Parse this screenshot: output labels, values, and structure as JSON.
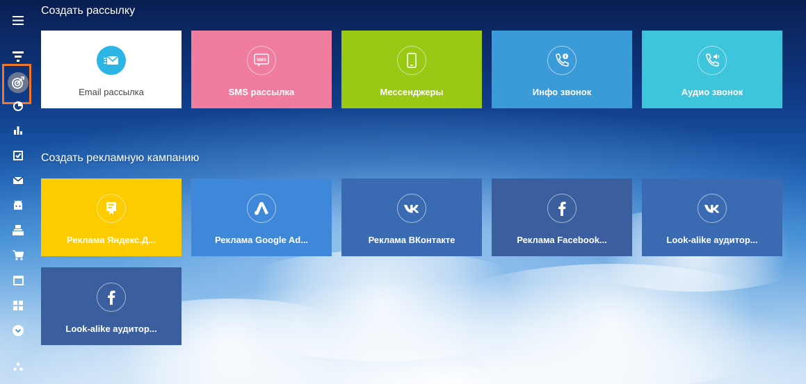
{
  "colors": {
    "email": "#ffffff",
    "sms": "#f07ca0",
    "messengers": "#99c815",
    "info_call": "#3a9bd8",
    "audio_call": "#3ec5dc",
    "yandex": "#fdcc00",
    "google": "#3f87d9",
    "vk": "#3a6ab2",
    "facebook": "#3b5e9e",
    "active_outline": "#f0772a"
  },
  "sidebar": {
    "items": [
      {
        "icon": "menu-icon"
      },
      {
        "icon": "funnel-icon"
      },
      {
        "icon": "target-icon",
        "active": true
      },
      {
        "icon": "pie-chart-icon"
      },
      {
        "icon": "bar-chart-icon"
      },
      {
        "icon": "checkbox-icon"
      },
      {
        "icon": "envelope-icon"
      },
      {
        "icon": "android-icon"
      },
      {
        "icon": "inbox-icon"
      },
      {
        "icon": "cart-icon"
      },
      {
        "icon": "browser-window-icon"
      },
      {
        "icon": "apps-grid-icon"
      },
      {
        "icon": "chevron-down-circle-icon"
      },
      {
        "icon": "network-icon"
      }
    ]
  },
  "mailing": {
    "title": "Создать рассылку",
    "tiles": [
      {
        "label": "Email рассылка",
        "icon": "email-icon"
      },
      {
        "label": "SMS рассылка",
        "icon": "sms-icon"
      },
      {
        "label": "Мессенджеры",
        "icon": "phone-icon"
      },
      {
        "label": "Инфо звонок",
        "icon": "info-call-icon"
      },
      {
        "label": "Аудио звонок",
        "icon": "audio-call-icon"
      }
    ]
  },
  "ads": {
    "title": "Создать рекламную кампанию",
    "tiles": [
      {
        "label": "Реклама Яндекс.Д...",
        "icon": "yandex-direct-icon"
      },
      {
        "label": "Реклама Google Ad...",
        "icon": "google-ads-icon"
      },
      {
        "label": "Реклама ВКонтакте",
        "icon": "vk-icon"
      },
      {
        "label": "Реклама Facebook...",
        "icon": "facebook-icon"
      },
      {
        "label": "Look-alike аудитор...",
        "icon": "vk-icon"
      },
      {
        "label": "Look-alike аудитор...",
        "icon": "facebook-icon"
      }
    ]
  }
}
